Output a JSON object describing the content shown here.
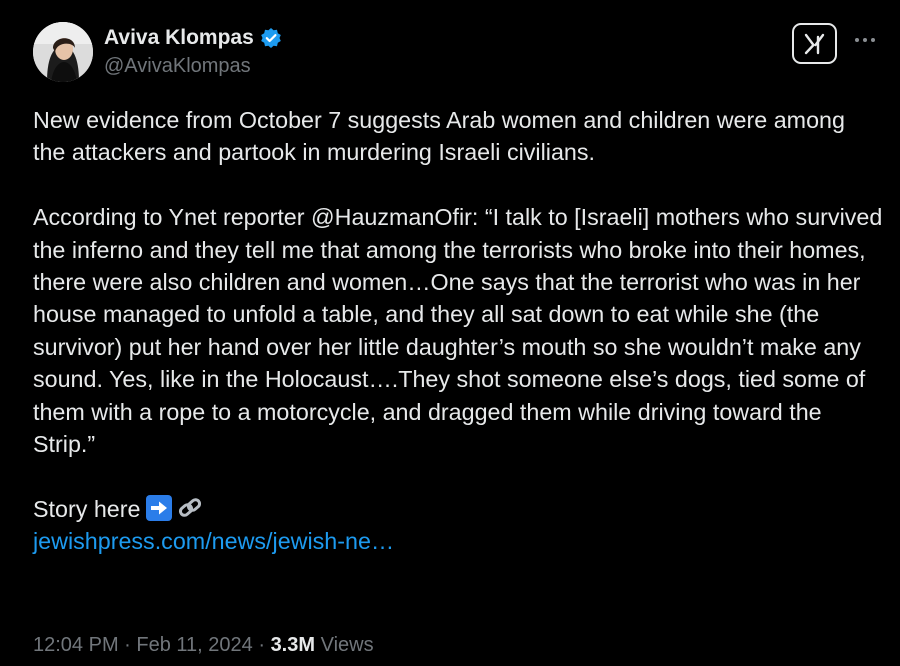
{
  "author": {
    "display_name": "Aviva Klompas",
    "handle": "@AvivaKlompas",
    "avatar_icon": "profile-photo",
    "verified_icon": "verified-badge-icon",
    "verified_color": "#1d9bf0"
  },
  "header_actions": {
    "x_button_icon": "x-logo-icon",
    "more_icon": "more-options-icon"
  },
  "body": {
    "paragraph_1": "New evidence from October 7 suggests Arab women and children were among the attackers and partook in murdering Israeli civilians.",
    "paragraph_2": "According to Ynet reporter @HauzmanOfir: “I talk to [Israeli] mothers who survived the inferno and they tell me that among the terrorists who broke into their homes, there were also children and women…One says that the terrorist who was in her house managed to unfold a table, and they all sat down to eat while she (the survivor) put her hand over her little daughter’s mouth so she wouldn’t make any sound. Yes, like in the Holocaust….They shot someone else’s dogs, tied some of them with a rope to a motorcycle, and dragged them while driving toward the Strip.”",
    "story_label": "Story here",
    "arrow_emoji_icon": "right-arrow-emoji-icon",
    "link_emoji_icon": "link-emoji-icon",
    "link_text": "jewishpress.com/news/jewish-ne…",
    "link_color": "#1d9bf0"
  },
  "meta": {
    "time": "12:04 PM",
    "separator": " · ",
    "date": "Feb 11, 2024",
    "views_count": "3.3M",
    "views_label": " Views"
  },
  "colors": {
    "background": "#000000",
    "text_primary": "#e7e9ea",
    "text_secondary": "#71767b"
  }
}
